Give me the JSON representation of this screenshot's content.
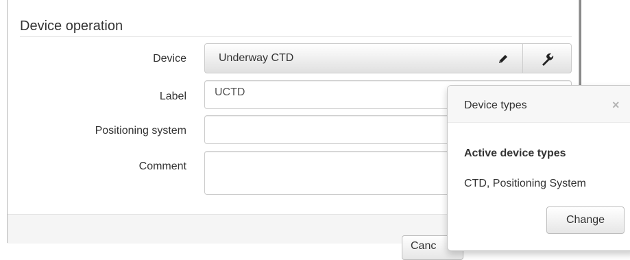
{
  "form": {
    "section_title": "Device operation",
    "device": {
      "label": "Device",
      "value": "Underway CTD",
      "edit_icon": "pencil-icon",
      "types_icon": "wrench-icon"
    },
    "label_field": {
      "label": "Label",
      "value": "UCTD"
    },
    "positioning": {
      "label": "Positioning system",
      "value": ""
    },
    "comment": {
      "label": "Comment",
      "value": ""
    }
  },
  "footer": {
    "button_label": "Canc"
  },
  "popover": {
    "title": "Device types",
    "close_icon": "close-icon",
    "close_glyph": "×",
    "subtitle": "Active device types",
    "types_text": "CTD, Positioning System",
    "change_label": "Change"
  }
}
